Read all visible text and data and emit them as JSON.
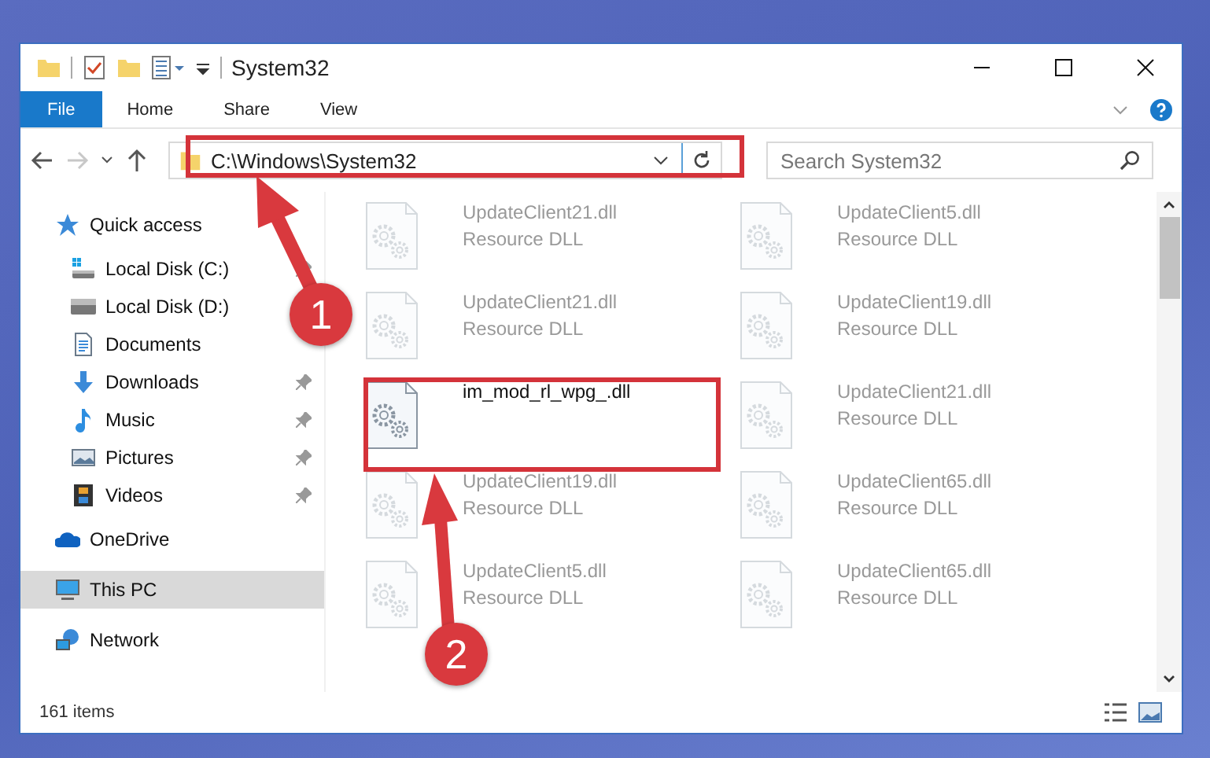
{
  "window": {
    "title": "System32"
  },
  "ribbon": {
    "tabs": [
      {
        "label": "File",
        "selected": true
      },
      {
        "label": "Home",
        "selected": false
      },
      {
        "label": "Share",
        "selected": false
      },
      {
        "label": "View",
        "selected": false
      }
    ]
  },
  "address_bar": {
    "path": "C:\\Windows\\System32",
    "search": {
      "placeholder": "Search System32"
    },
    "forward_disabled": true
  },
  "sidebar": {
    "items": [
      {
        "label": "Quick access",
        "kind": "star",
        "selected": false,
        "children": [
          {
            "label": "Local Disk (C:)",
            "kind": "drive-win",
            "pinned": true
          },
          {
            "label": "Local Disk (D:)",
            "kind": "drive",
            "pinned": false
          },
          {
            "label": "Documents",
            "kind": "documents",
            "pinned": false
          },
          {
            "label": "Downloads",
            "kind": "downloads",
            "pinned": true
          },
          {
            "label": "Music",
            "kind": "music",
            "pinned": true
          },
          {
            "label": "Pictures",
            "kind": "pictures",
            "pinned": true
          },
          {
            "label": "Videos",
            "kind": "videos",
            "pinned": true
          }
        ]
      },
      {
        "label": "OneDrive",
        "kind": "cloud",
        "selected": false
      },
      {
        "label": "This PC",
        "kind": "pc",
        "selected": true
      },
      {
        "label": "Network",
        "kind": "network",
        "selected": false
      }
    ]
  },
  "files": [
    {
      "name": "UpdateClient21.dll",
      "type": "Resource DLL",
      "faded": true
    },
    {
      "name": "UpdateClient5.dll",
      "type": "Resource DLL",
      "faded": true
    },
    {
      "name": "UpdateClient21.dll",
      "type": "Resource DLL",
      "faded": true
    },
    {
      "name": "UpdateClient19.dll",
      "type": "Resource DLL",
      "faded": true
    },
    {
      "name": "im_mod_rl_wpg_.dll",
      "faded": false
    },
    {
      "name": "UpdateClient21.dll",
      "type": "Resource DLL",
      "faded": true
    },
    {
      "name": "UpdateClient19.dll",
      "type": "Resource DLL",
      "faded": true
    },
    {
      "name": "UpdateClient65.dll",
      "type": "Resource DLL",
      "faded": true
    },
    {
      "name": "UpdateClient5.dll",
      "type": "Resource DLL",
      "faded": true
    },
    {
      "name": "UpdateClient65.dll",
      "type": "Resource DLL",
      "faded": true
    }
  ],
  "status_bar": {
    "item_count": "161 items"
  },
  "annotations": [
    {
      "label": "1"
    },
    {
      "label": "2"
    }
  ]
}
